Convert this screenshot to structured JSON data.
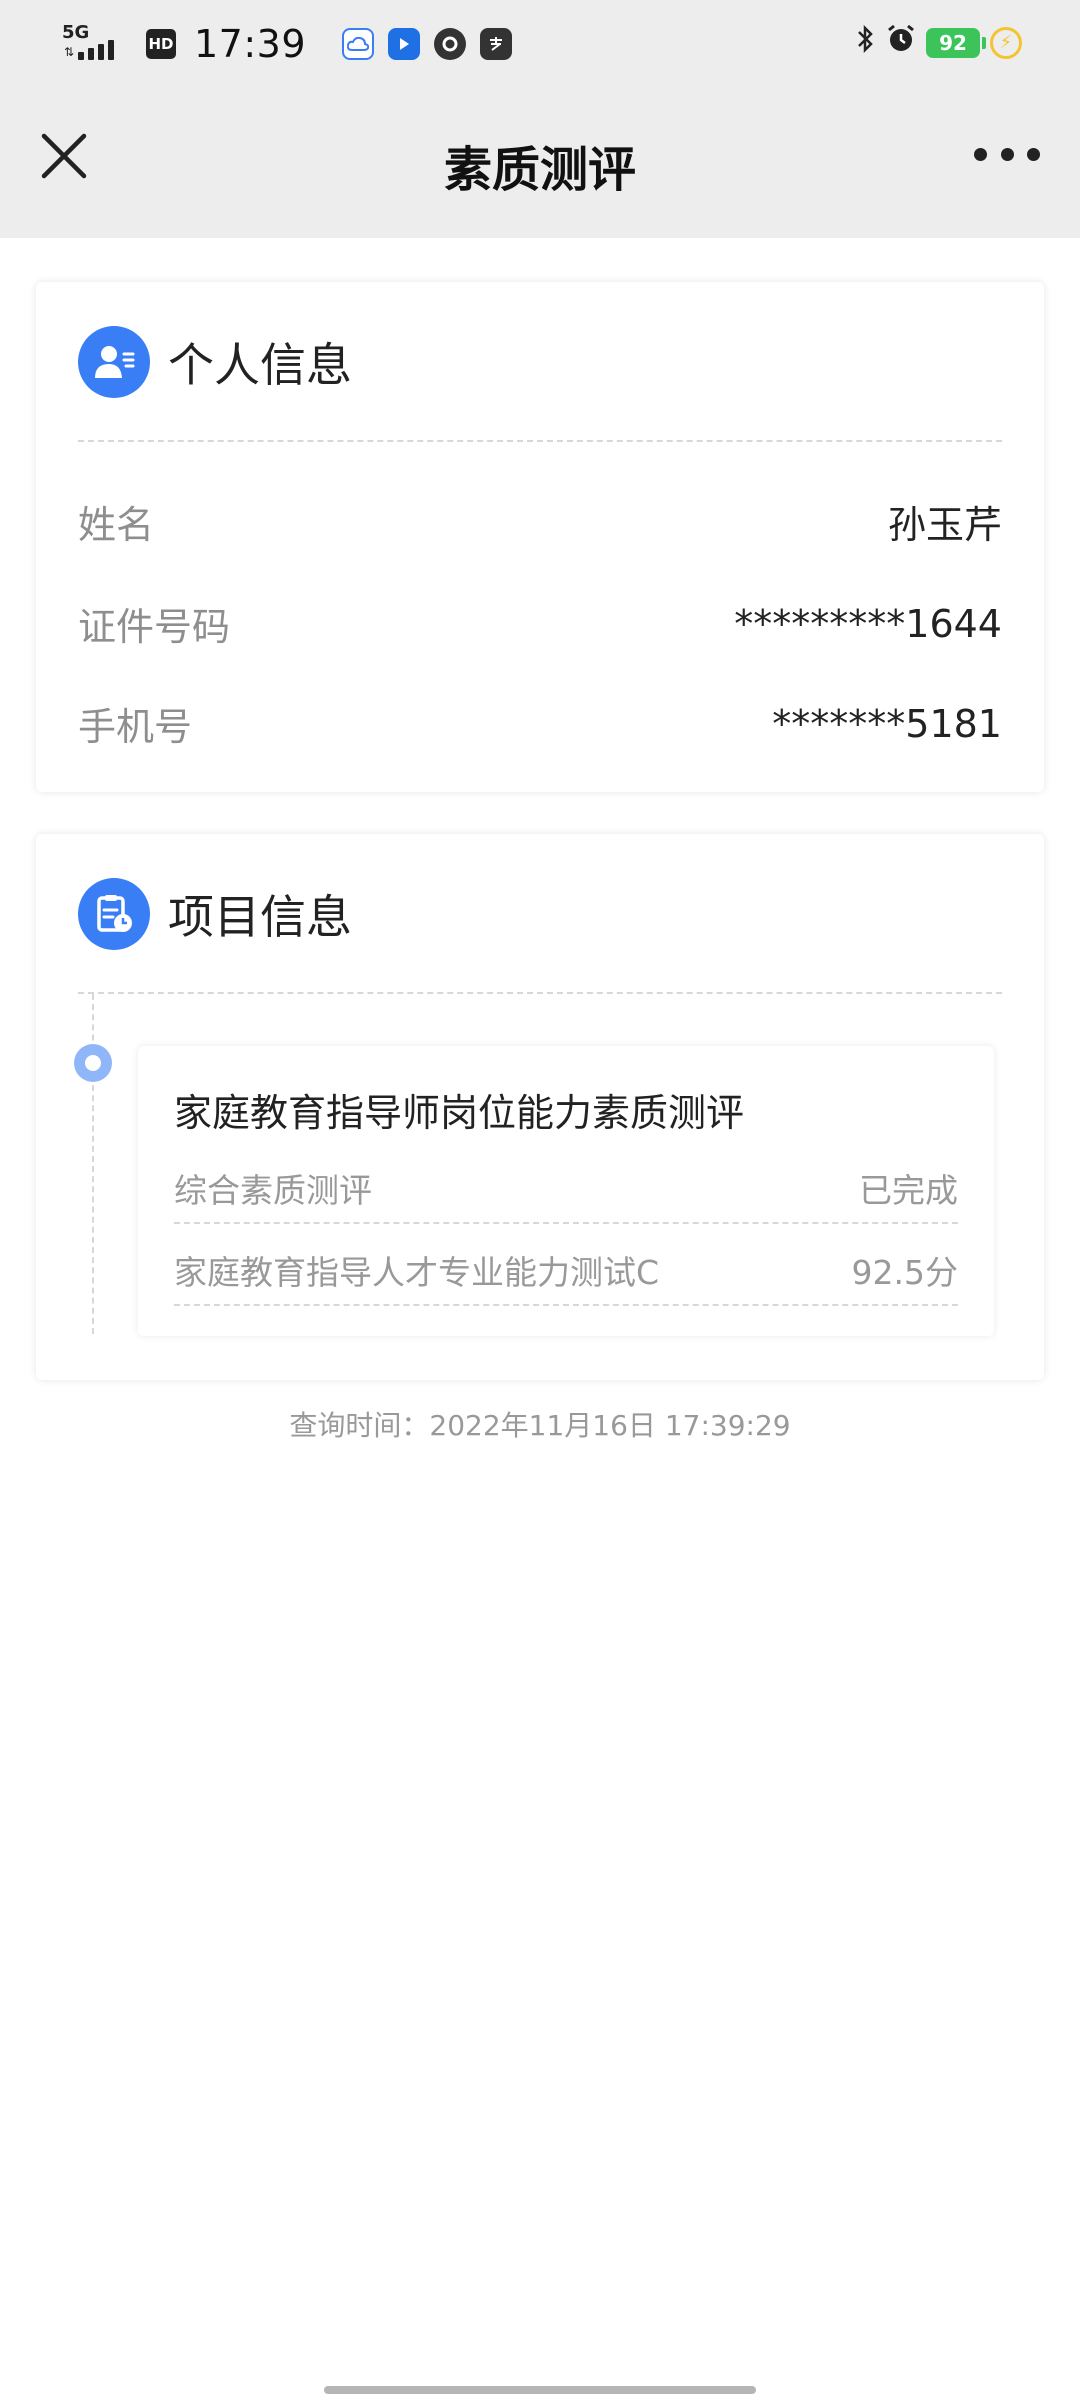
{
  "status_bar": {
    "network": "5G",
    "hd": "HD",
    "time": "17:39",
    "battery": "92"
  },
  "nav": {
    "title": "素质测评"
  },
  "personal": {
    "heading": "个人信息",
    "rows": [
      {
        "label": "姓名",
        "value": "孙玉芹"
      },
      {
        "label": "证件号码",
        "value": "*********1644"
      },
      {
        "label": "手机号",
        "value": "*******5181"
      }
    ]
  },
  "project": {
    "heading": "项目信息",
    "item": {
      "title": "家庭教育指导师岗位能力素质测评",
      "rows": [
        {
          "label": "综合素质测评",
          "value": "已完成"
        },
        {
          "label": "家庭教育指导人才专业能力测试C",
          "value": "92.5分"
        }
      ]
    }
  },
  "footer": {
    "query_time": "查询时间：2022年11月16日 17:39:29"
  },
  "colors": {
    "accent": "#3a7ef5",
    "top_bg": "#ededed",
    "battery": "#3cc45a"
  }
}
